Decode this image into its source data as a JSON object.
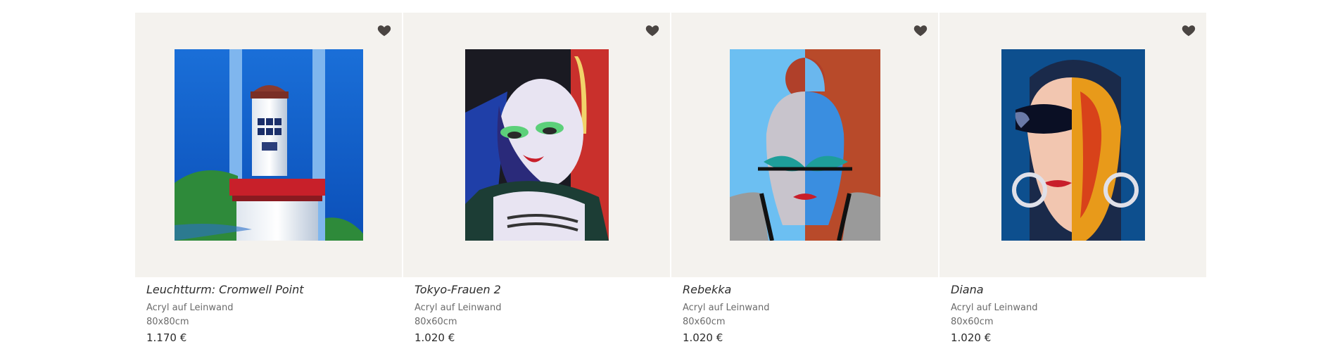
{
  "products": [
    {
      "title": "Leuchtturm: Cromwell Point",
      "medium": "Acryl auf Leinwand",
      "size": "80x80cm",
      "price": "1.170 €",
      "icon": "heart-icon"
    },
    {
      "title": "Tokyo-Frauen 2",
      "medium": "Acryl auf Leinwand",
      "size": "80x60cm",
      "price": "1.020 €",
      "icon": "heart-icon"
    },
    {
      "title": "Rebekka",
      "medium": "Acryl auf Leinwand",
      "size": "80x60cm",
      "price": "1.020 €",
      "icon": "heart-icon"
    },
    {
      "title": "Diana",
      "medium": "Acryl auf Leinwand",
      "size": "80x60cm",
      "price": "1.020 €",
      "icon": "heart-icon"
    }
  ],
  "colors": {
    "tile_background": "#f4f2ee",
    "heart": "#4a4542"
  }
}
